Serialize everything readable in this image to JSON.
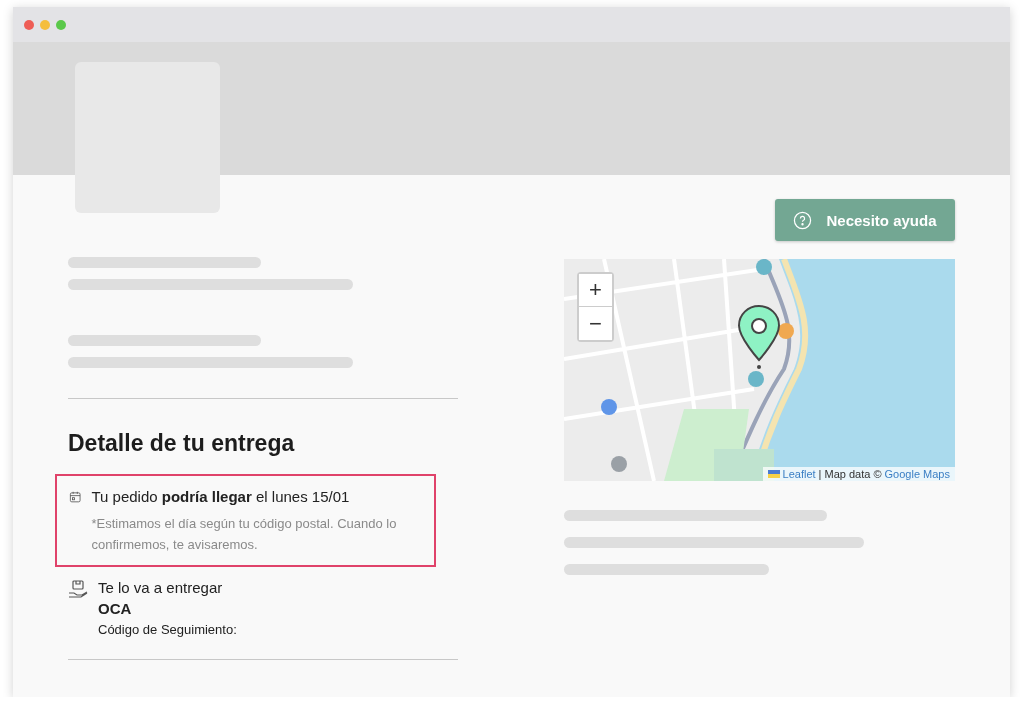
{
  "help_button": {
    "label": "Necesito ayuda"
  },
  "delivery": {
    "title": "Detalle de tu entrega",
    "estimate": {
      "text": "Tu pedido **podría llegar** el lunes 15/01",
      "note": "*Estimamos el día según tu código postal. Cuando lo confirmemos, te avisaremos.",
      "highlighted": true
    },
    "carrier": {
      "label": "Te lo va a entregar",
      "name": "OCA",
      "tracking_label": "Código de Seguimiento:"
    }
  },
  "map": {
    "zoom_in": "+",
    "zoom_out": "−",
    "attribution": {
      "leaflet": "Leaflet",
      "separator": "| Map data ©",
      "source": "Google Maps"
    }
  }
}
